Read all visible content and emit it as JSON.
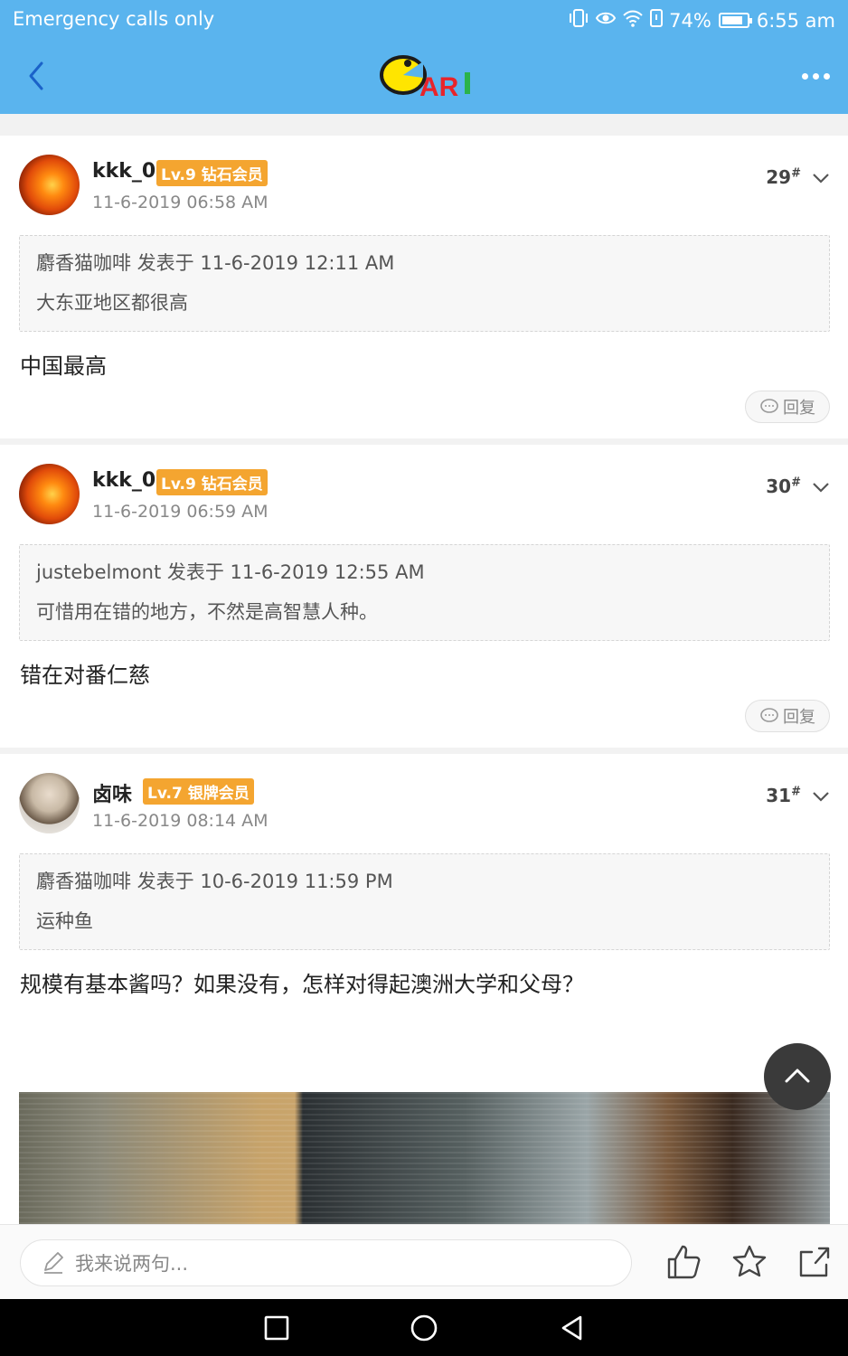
{
  "status": {
    "left_text": "Emergency calls only",
    "battery": "74%",
    "battery_level": 0.74,
    "time": "6:55 am"
  },
  "header": {
    "logo_text": "AR",
    "icons": [
      "back-icon",
      "more-icon"
    ]
  },
  "posts": [
    {
      "username": "kkk_0",
      "badge": "Lv.9 钻石会员",
      "time": "11-6-2019 06:58 AM",
      "floor": "29",
      "floor_mark": "#",
      "quote_header": "麝香猫咖啡 发表于 11-6-2019 12:11 AM",
      "quote_text": "大东亚地区都很高",
      "body": "中国最高",
      "reply_label": "回复"
    },
    {
      "username": "kkk_0",
      "badge": "Lv.9 钻石会员",
      "time": "11-6-2019 06:59 AM",
      "floor": "30",
      "floor_mark": "#",
      "quote_header": "justebelmont 发表于 11-6-2019 12:55 AM",
      "quote_text": "可惜用在错的地方，不然是高智慧人种。",
      "body": "错在对番仁慈",
      "reply_label": "回复"
    },
    {
      "username": "卤味",
      "badge": "Lv.7 银牌会员",
      "time": "11-6-2019 08:14 AM",
      "floor": "31",
      "floor_mark": "#",
      "quote_header": "麝香猫咖啡 发表于 10-6-2019 11:59 PM",
      "quote_text": "运种鱼",
      "body": "规模有基本酱吗？如果没有，怎样对得起澳洲大学和父母？"
    }
  ],
  "bottom": {
    "input_placeholder": "我来说两句...",
    "icons": [
      "like-icon",
      "star-icon",
      "share-icon"
    ]
  },
  "colors": {
    "header": "#5ab4ee",
    "badge": "#f4a530"
  }
}
